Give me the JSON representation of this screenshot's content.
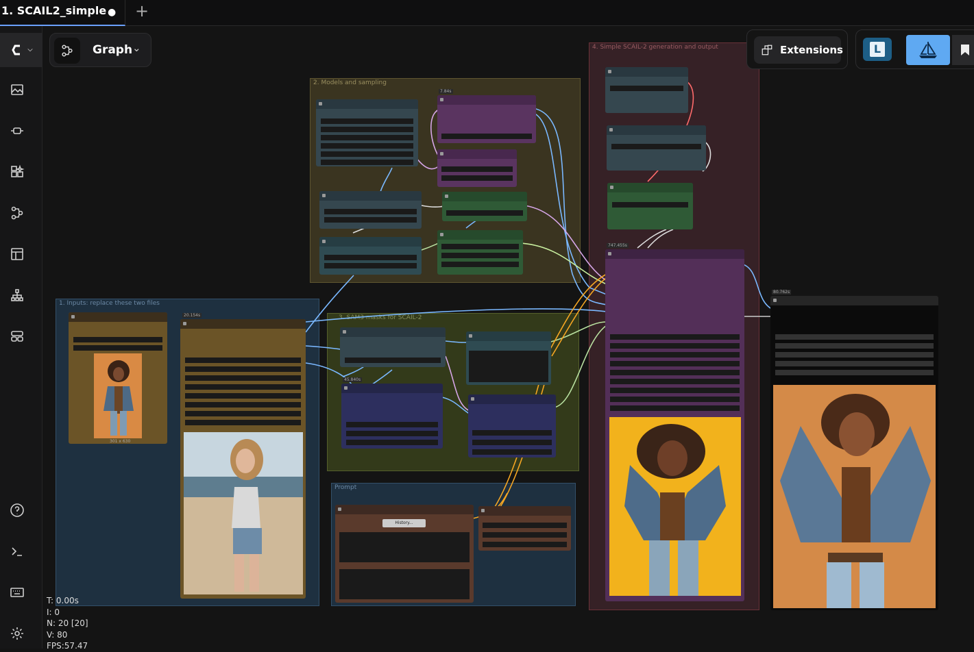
{
  "tab": {
    "title": "1. SCAIL2_simple",
    "dirty": "●",
    "add": "+"
  },
  "toolbar": {
    "graph_label": "Graph",
    "chevron": "⌄",
    "extensions_label": "Extensions",
    "l_logo": "L"
  },
  "sidebar": {
    "icons": [
      "comfy-logo-icon",
      "images-icon",
      "models-icon",
      "nodes-library-icon",
      "workflows-icon",
      "templates-icon",
      "node-map-icon",
      "apps-icon",
      "help-icon",
      "terminal-icon",
      "keyboard-icon",
      "settings-icon"
    ]
  },
  "groups": {
    "inputs": "1. Inputs: replace these two files",
    "models": "2. Models and sampling",
    "sam": "3. SAM3 masks for SCAIL-2",
    "generation": "4. Simple SCAIL-2 generation and output",
    "prompt": "Prompt"
  },
  "nodes": {
    "history_button": "History..."
  },
  "badges": {
    "b1": "7.84s",
    "b2": "20.154s",
    "b3": "45.840s",
    "b4": "747.455s",
    "b5": "80.762s",
    "b6": "301 x 630"
  },
  "stats": {
    "t": "T: 0.00s",
    "i": "I: 0",
    "n": "N: 20 [20]",
    "v": "V: 80",
    "fps": "FPS:57.47"
  },
  "colors": {
    "accent": "#6aa0ff",
    "purple_node": "#5a3460",
    "green_node": "#2f5a36",
    "slate_node": "#33454f",
    "brown_node": "#6b5427",
    "navy_node": "#2d2f5e"
  }
}
